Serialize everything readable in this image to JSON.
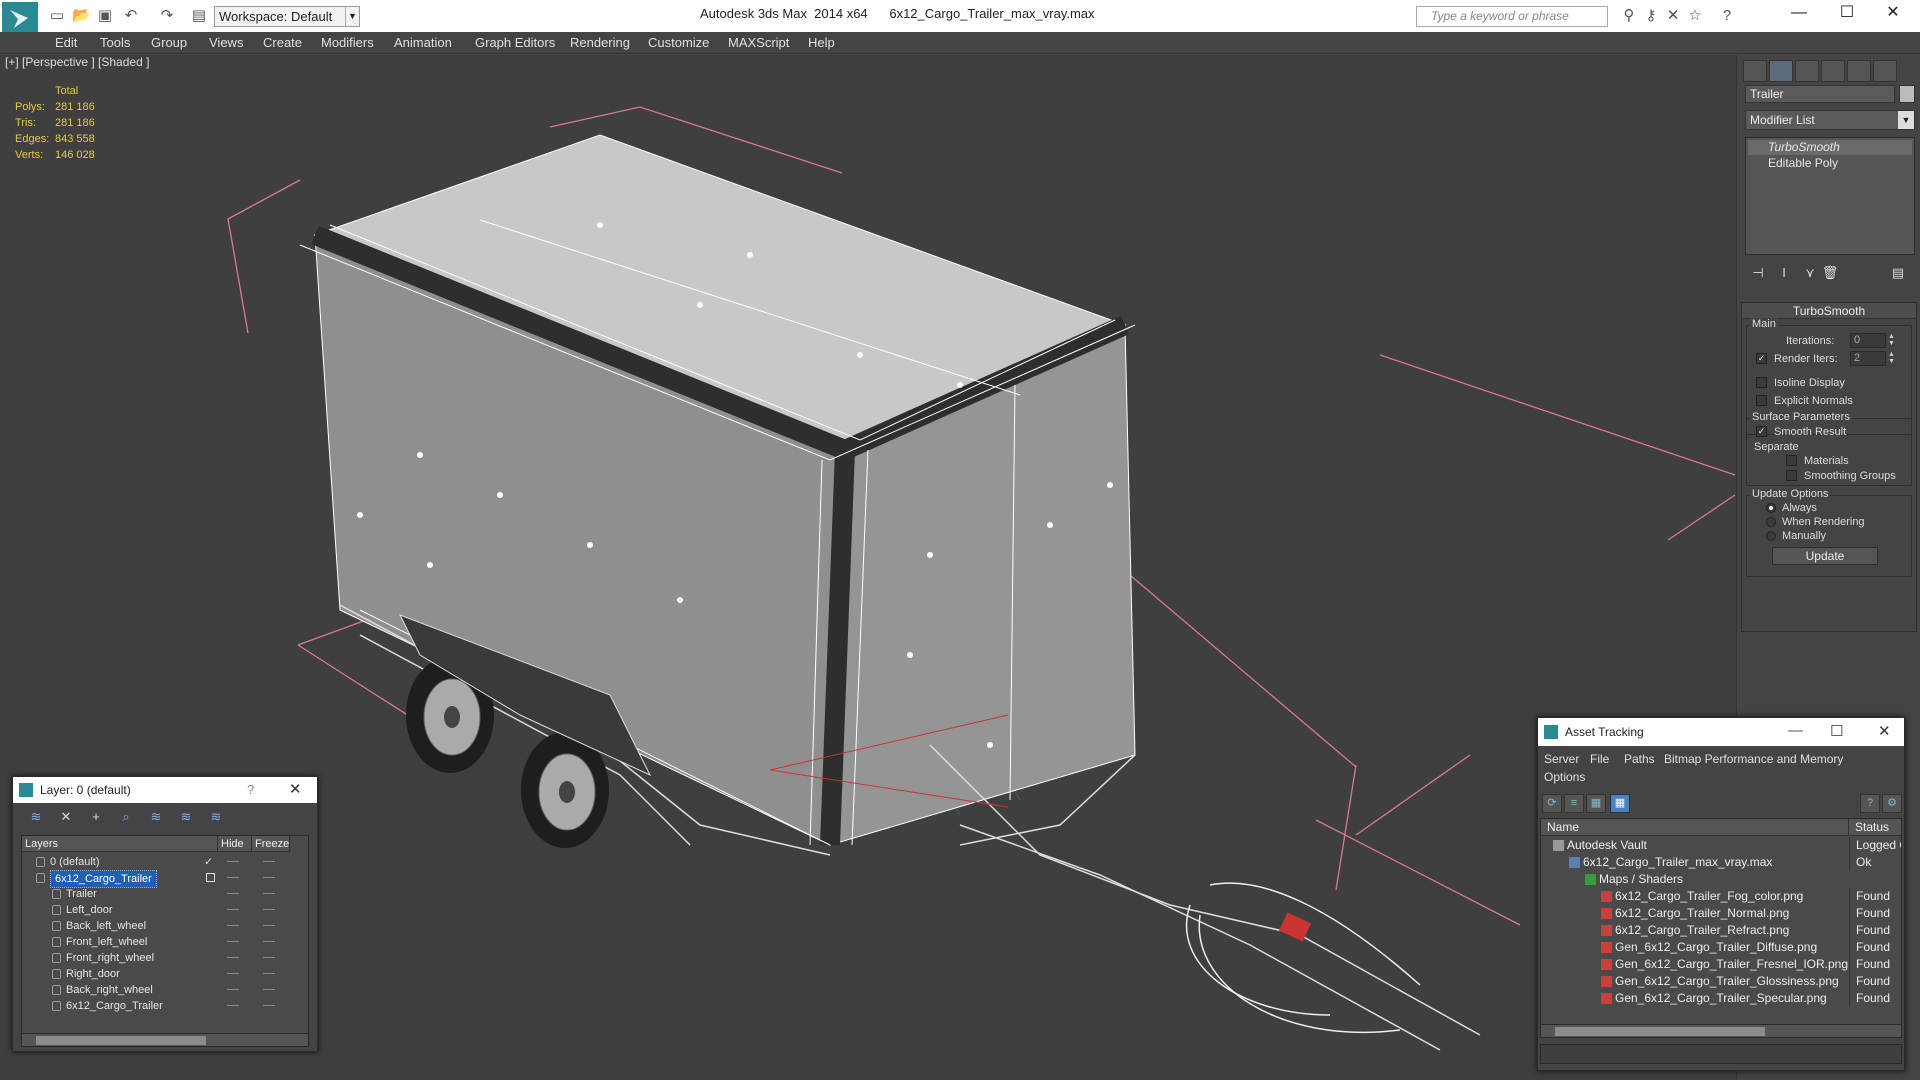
{
  "titlebar": {
    "workspace": "Workspace: Default",
    "app_title": "Autodesk 3ds Max  2014 x64",
    "file_title": "6x12_Cargo_Trailer_max_vray.max",
    "search_placeholder": "Type a keyword or phrase"
  },
  "menu": [
    "Edit",
    "Tools",
    "Group",
    "Views",
    "Create",
    "Modifiers",
    "Animation",
    "Graph Editors",
    "Rendering",
    "Customize",
    "MAXScript",
    "Help"
  ],
  "viewport": {
    "label": "[+] [Perspective ] [Shaded ]",
    "stats_header": "Total",
    "stats": [
      {
        "label": "Polys:",
        "value": "281 186"
      },
      {
        "label": "Tris:",
        "value": "281 186"
      },
      {
        "label": "Edges:",
        "value": "843 558"
      },
      {
        "label": "Verts:",
        "value": "146 028"
      }
    ]
  },
  "command_panel": {
    "object_name": "Trailer",
    "modifier_list": "Modifier List",
    "stack": [
      "TurboSmooth",
      "Editable Poly"
    ],
    "rollout_title": "TurboSmooth",
    "main_group": "Main",
    "iterations_label": "Iterations:",
    "iterations_value": "0",
    "render_iters_label": "Render Iters:",
    "render_iters_value": "2",
    "isoline": "Isoline Display",
    "explicit_normals": "Explicit Normals",
    "surface_group": "Surface Parameters",
    "smooth_result": "Smooth Result",
    "separate": "Separate",
    "materials": "Materials",
    "smoothing_groups": "Smoothing Groups",
    "update_group": "Update Options",
    "always": "Always",
    "when_rendering": "When Rendering",
    "manually": "Manually",
    "update_button": "Update"
  },
  "layer_window": {
    "title": "Layer: 0 (default)",
    "help": "?",
    "columns": [
      "Layers",
      "Hide",
      "Freeze"
    ],
    "rows": [
      {
        "name": "0 (default)",
        "indent": 1
      },
      {
        "name": "6x12_Cargo_Trailer",
        "indent": 1
      },
      {
        "name": "Trailer",
        "indent": 2
      },
      {
        "name": "Left_door",
        "indent": 2
      },
      {
        "name": "Back_left_wheel",
        "indent": 2
      },
      {
        "name": "Front_left_wheel",
        "indent": 2
      },
      {
        "name": "Front_right_wheel",
        "indent": 2
      },
      {
        "name": "Right_door",
        "indent": 2
      },
      {
        "name": "Back_right_wheel",
        "indent": 2
      },
      {
        "name": "6x12_Cargo_Trailer",
        "indent": 2
      }
    ]
  },
  "asset_window": {
    "title": "Asset Tracking",
    "menu": [
      "Server",
      "File",
      "Paths",
      "Bitmap Performance and Memory",
      "Options"
    ],
    "columns": [
      "Name",
      "Status"
    ],
    "rows": [
      {
        "name": "Autodesk Vault",
        "status": "Logged O",
        "indent": 1
      },
      {
        "name": "6x12_Cargo_Trailer_max_vray.max",
        "status": "Ok",
        "indent": 2
      },
      {
        "name": "Maps / Shaders",
        "status": "",
        "indent": 3
      },
      {
        "name": "6x12_Cargo_Trailer_Fog_color.png",
        "status": "Found",
        "indent": 4
      },
      {
        "name": "6x12_Cargo_Trailer_Normal.png",
        "status": "Found",
        "indent": 4
      },
      {
        "name": "6x12_Cargo_Trailer_Refract.png",
        "status": "Found",
        "indent": 4
      },
      {
        "name": "Gen_6x12_Cargo_Trailer_Diffuse.png",
        "status": "Found",
        "indent": 4
      },
      {
        "name": "Gen_6x12_Cargo_Trailer_Fresnel_IOR.png",
        "status": "Found",
        "indent": 4
      },
      {
        "name": "Gen_6x12_Cargo_Trailer_Glossiness.png",
        "status": "Found",
        "indent": 4
      },
      {
        "name": "Gen_6x12_Cargo_Trailer_Specular.png",
        "status": "Found",
        "indent": 4
      }
    ]
  }
}
